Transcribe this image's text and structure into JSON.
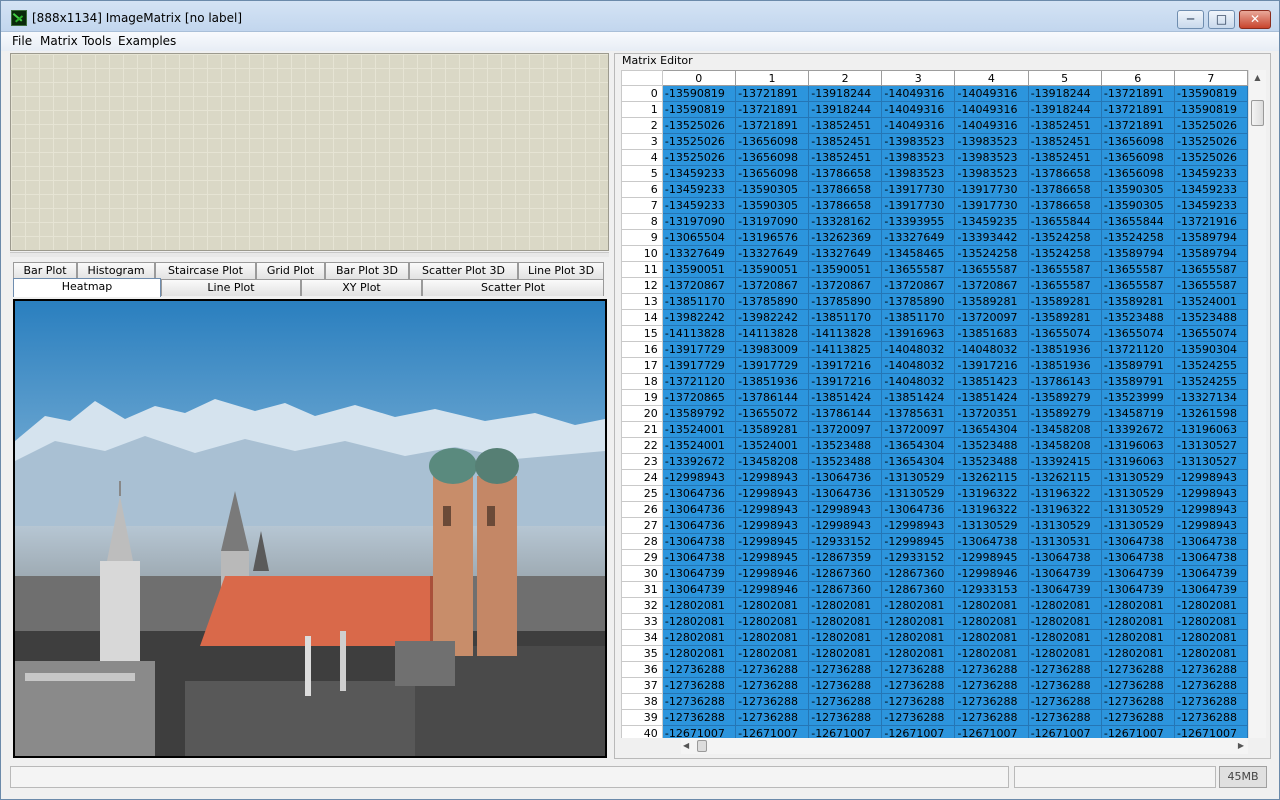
{
  "window": {
    "title": "[888x1134] ImageMatrix [no label]"
  },
  "menu": [
    "File",
    "Matrix",
    "Tools",
    "Examples"
  ],
  "tabs_row1": [
    "Bar Plot",
    "Histogram",
    "Staircase Plot",
    "Grid Plot",
    "Bar Plot 3D",
    "Scatter Plot 3D",
    "Line Plot 3D"
  ],
  "tabs_row2": [
    "Heatmap",
    "Line Plot",
    "XY Plot",
    "Scatter Plot"
  ],
  "active_tab": "Heatmap",
  "editor": {
    "label": "Matrix Editor",
    "columns": [
      "0",
      "1",
      "2",
      "3",
      "4",
      "5",
      "6",
      "7"
    ],
    "rows": [
      [
        "-13590819",
        "-13721891",
        "-13918244",
        "-14049316",
        "-14049316",
        "-13918244",
        "-13721891",
        "-13590819"
      ],
      [
        "-13590819",
        "-13721891",
        "-13918244",
        "-14049316",
        "-14049316",
        "-13918244",
        "-13721891",
        "-13590819"
      ],
      [
        "-13525026",
        "-13721891",
        "-13852451",
        "-14049316",
        "-14049316",
        "-13852451",
        "-13721891",
        "-13525026"
      ],
      [
        "-13525026",
        "-13656098",
        "-13852451",
        "-13983523",
        "-13983523",
        "-13852451",
        "-13656098",
        "-13525026"
      ],
      [
        "-13525026",
        "-13656098",
        "-13852451",
        "-13983523",
        "-13983523",
        "-13852451",
        "-13656098",
        "-13525026"
      ],
      [
        "-13459233",
        "-13656098",
        "-13786658",
        "-13983523",
        "-13983523",
        "-13786658",
        "-13656098",
        "-13459233"
      ],
      [
        "-13459233",
        "-13590305",
        "-13786658",
        "-13917730",
        "-13917730",
        "-13786658",
        "-13590305",
        "-13459233"
      ],
      [
        "-13459233",
        "-13590305",
        "-13786658",
        "-13917730",
        "-13917730",
        "-13786658",
        "-13590305",
        "-13459233"
      ],
      [
        "-13197090",
        "-13197090",
        "-13328162",
        "-13393955",
        "-13459235",
        "-13655844",
        "-13655844",
        "-13721916"
      ],
      [
        "-13065504",
        "-13196576",
        "-13262369",
        "-13327649",
        "-13393442",
        "-13524258",
        "-13524258",
        "-13589794"
      ],
      [
        "-13327649",
        "-13327649",
        "-13327649",
        "-13458465",
        "-13524258",
        "-13524258",
        "-13589794",
        "-13589794"
      ],
      [
        "-13590051",
        "-13590051",
        "-13590051",
        "-13655587",
        "-13655587",
        "-13655587",
        "-13655587",
        "-13655587"
      ],
      [
        "-13720867",
        "-13720867",
        "-13720867",
        "-13720867",
        "-13720867",
        "-13655587",
        "-13655587",
        "-13655587"
      ],
      [
        "-13851170",
        "-13785890",
        "-13785890",
        "-13785890",
        "-13589281",
        "-13589281",
        "-13589281",
        "-13524001"
      ],
      [
        "-13982242",
        "-13982242",
        "-13851170",
        "-13851170",
        "-13720097",
        "-13589281",
        "-13523488",
        "-13523488"
      ],
      [
        "-14113828",
        "-14113828",
        "-14113828",
        "-13916963",
        "-13851683",
        "-13655074",
        "-13655074",
        "-13655074"
      ],
      [
        "-13917729",
        "-13983009",
        "-14113825",
        "-14048032",
        "-14048032",
        "-13851936",
        "-13721120",
        "-13590304"
      ],
      [
        "-13917729",
        "-13917729",
        "-13917216",
        "-14048032",
        "-13917216",
        "-13851936",
        "-13589791",
        "-13524255"
      ],
      [
        "-13721120",
        "-13851936",
        "-13917216",
        "-14048032",
        "-13851423",
        "-13786143",
        "-13589791",
        "-13524255"
      ],
      [
        "-13720865",
        "-13786144",
        "-13851424",
        "-13851424",
        "-13851424",
        "-13589279",
        "-13523999",
        "-13327134"
      ],
      [
        "-13589792",
        "-13655072",
        "-13786144",
        "-13785631",
        "-13720351",
        "-13589279",
        "-13458719",
        "-13261598"
      ],
      [
        "-13524001",
        "-13589281",
        "-13720097",
        "-13720097",
        "-13654304",
        "-13458208",
        "-13392672",
        "-13196063"
      ],
      [
        "-13524001",
        "-13524001",
        "-13523488",
        "-13654304",
        "-13523488",
        "-13458208",
        "-13196063",
        "-13130527"
      ],
      [
        "-13392672",
        "-13458208",
        "-13523488",
        "-13654304",
        "-13523488",
        "-13392415",
        "-13196063",
        "-13130527"
      ],
      [
        "-12998943",
        "-12998943",
        "-13064736",
        "-13130529",
        "-13262115",
        "-13262115",
        "-13130529",
        "-12998943"
      ],
      [
        "-13064736",
        "-12998943",
        "-13064736",
        "-13130529",
        "-13196322",
        "-13196322",
        "-13130529",
        "-12998943"
      ],
      [
        "-13064736",
        "-12998943",
        "-12998943",
        "-13064736",
        "-13196322",
        "-13196322",
        "-13130529",
        "-12998943"
      ],
      [
        "-13064736",
        "-12998943",
        "-12998943",
        "-12998943",
        "-13130529",
        "-13130529",
        "-13130529",
        "-12998943"
      ],
      [
        "-13064738",
        "-12998945",
        "-12933152",
        "-12998945",
        "-13064738",
        "-13130531",
        "-13064738",
        "-13064738"
      ],
      [
        "-13064738",
        "-12998945",
        "-12867359",
        "-12933152",
        "-12998945",
        "-13064738",
        "-13064738",
        "-13064738"
      ],
      [
        "-13064739",
        "-12998946",
        "-12867360",
        "-12867360",
        "-12998946",
        "-13064739",
        "-13064739",
        "-13064739"
      ],
      [
        "-13064739",
        "-12998946",
        "-12867360",
        "-12867360",
        "-12933153",
        "-13064739",
        "-13064739",
        "-13064739"
      ],
      [
        "-12802081",
        "-12802081",
        "-12802081",
        "-12802081",
        "-12802081",
        "-12802081",
        "-12802081",
        "-12802081"
      ],
      [
        "-12802081",
        "-12802081",
        "-12802081",
        "-12802081",
        "-12802081",
        "-12802081",
        "-12802081",
        "-12802081"
      ],
      [
        "-12802081",
        "-12802081",
        "-12802081",
        "-12802081",
        "-12802081",
        "-12802081",
        "-12802081",
        "-12802081"
      ],
      [
        "-12802081",
        "-12802081",
        "-12802081",
        "-12802081",
        "-12802081",
        "-12802081",
        "-12802081",
        "-12802081"
      ],
      [
        "-12736288",
        "-12736288",
        "-12736288",
        "-12736288",
        "-12736288",
        "-12736288",
        "-12736288",
        "-12736288"
      ],
      [
        "-12736288",
        "-12736288",
        "-12736288",
        "-12736288",
        "-12736288",
        "-12736288",
        "-12736288",
        "-12736288"
      ],
      [
        "-12736288",
        "-12736288",
        "-12736288",
        "-12736288",
        "-12736288",
        "-12736288",
        "-12736288",
        "-12736288"
      ],
      [
        "-12736288",
        "-12736288",
        "-12736288",
        "-12736288",
        "-12736288",
        "-12736288",
        "-12736288",
        "-12736288"
      ],
      [
        "-12671007",
        "-12671007",
        "-12671007",
        "-12671007",
        "-12671007",
        "-12671007",
        "-12671007",
        "-12671007"
      ]
    ]
  },
  "status": {
    "memory": "45MB"
  },
  "colors": {
    "cell_fill": "#2c95dd",
    "sky_top": "#2a7fbf",
    "roof": "#d9694a",
    "tower": "#c88d6a",
    "domes": "#5a8a7e"
  },
  "icons": {
    "minimize": "minimize-icon",
    "maximize": "maximize-icon",
    "close": "close-icon",
    "app": "app-icon"
  }
}
